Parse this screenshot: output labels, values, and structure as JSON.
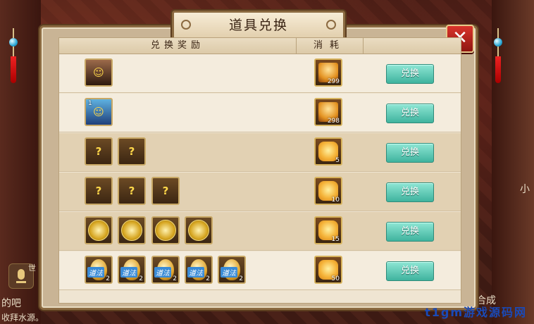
{
  "dialog": {
    "title": "道具兑换",
    "close_label": "✕",
    "header_reward": "兑换奖励",
    "header_cost": "消耗"
  },
  "rows": [
    {
      "rewards": [
        {
          "icon": "hero-portrait-male",
          "count": ""
        }
      ],
      "cost": {
        "icon": "golden-statue",
        "count": "299"
      },
      "button": "兑换"
    },
    {
      "rewards": [
        {
          "icon": "hero-portrait-female",
          "count": "",
          "level": "1"
        }
      ],
      "cost": {
        "icon": "golden-statue",
        "count": "298"
      },
      "button": "兑换"
    },
    {
      "rewards": [
        {
          "icon": "mystery-staff",
          "count": ""
        },
        {
          "icon": "mystery-staff",
          "count": ""
        }
      ],
      "cost": {
        "icon": "golden-puzzle",
        "count": "5"
      },
      "button": "兑换"
    },
    {
      "rewards": [
        {
          "icon": "mystery-mount",
          "count": ""
        },
        {
          "icon": "mystery-mount",
          "count": ""
        },
        {
          "icon": "mystery-mount",
          "count": ""
        }
      ],
      "cost": {
        "icon": "golden-puzzle",
        "count": "10"
      },
      "button": "兑换"
    },
    {
      "rewards": [
        {
          "icon": "gold-coin-charm",
          "count": ""
        },
        {
          "icon": "gold-coin-charm",
          "count": ""
        },
        {
          "icon": "gold-coin-charm",
          "count": ""
        },
        {
          "icon": "gold-coin-charm",
          "count": ""
        }
      ],
      "cost": {
        "icon": "golden-puzzle",
        "count": "15"
      },
      "button": "兑换"
    },
    {
      "rewards": [
        {
          "icon": "daofa-gourd",
          "count": "2",
          "tag": "道法"
        },
        {
          "icon": "daofa-gourd",
          "count": "2",
          "tag": "道法"
        },
        {
          "icon": "daofa-gourd",
          "count": "2",
          "tag": "道法"
        },
        {
          "icon": "daofa-gourd",
          "count": "2",
          "tag": "道法"
        },
        {
          "icon": "daofa-gourd",
          "count": "2",
          "tag": "道法"
        }
      ],
      "cost": {
        "icon": "golden-puzzle",
        "count": "50"
      },
      "button": "兑换"
    }
  ],
  "background": {
    "chat_snippet_1": "的吧",
    "chat_snippet_2": "收拜水源。",
    "side_char_left": "世",
    "side_text_right": "合成",
    "side_char_right": "小"
  },
  "watermark": "t1gm游戏源码网"
}
